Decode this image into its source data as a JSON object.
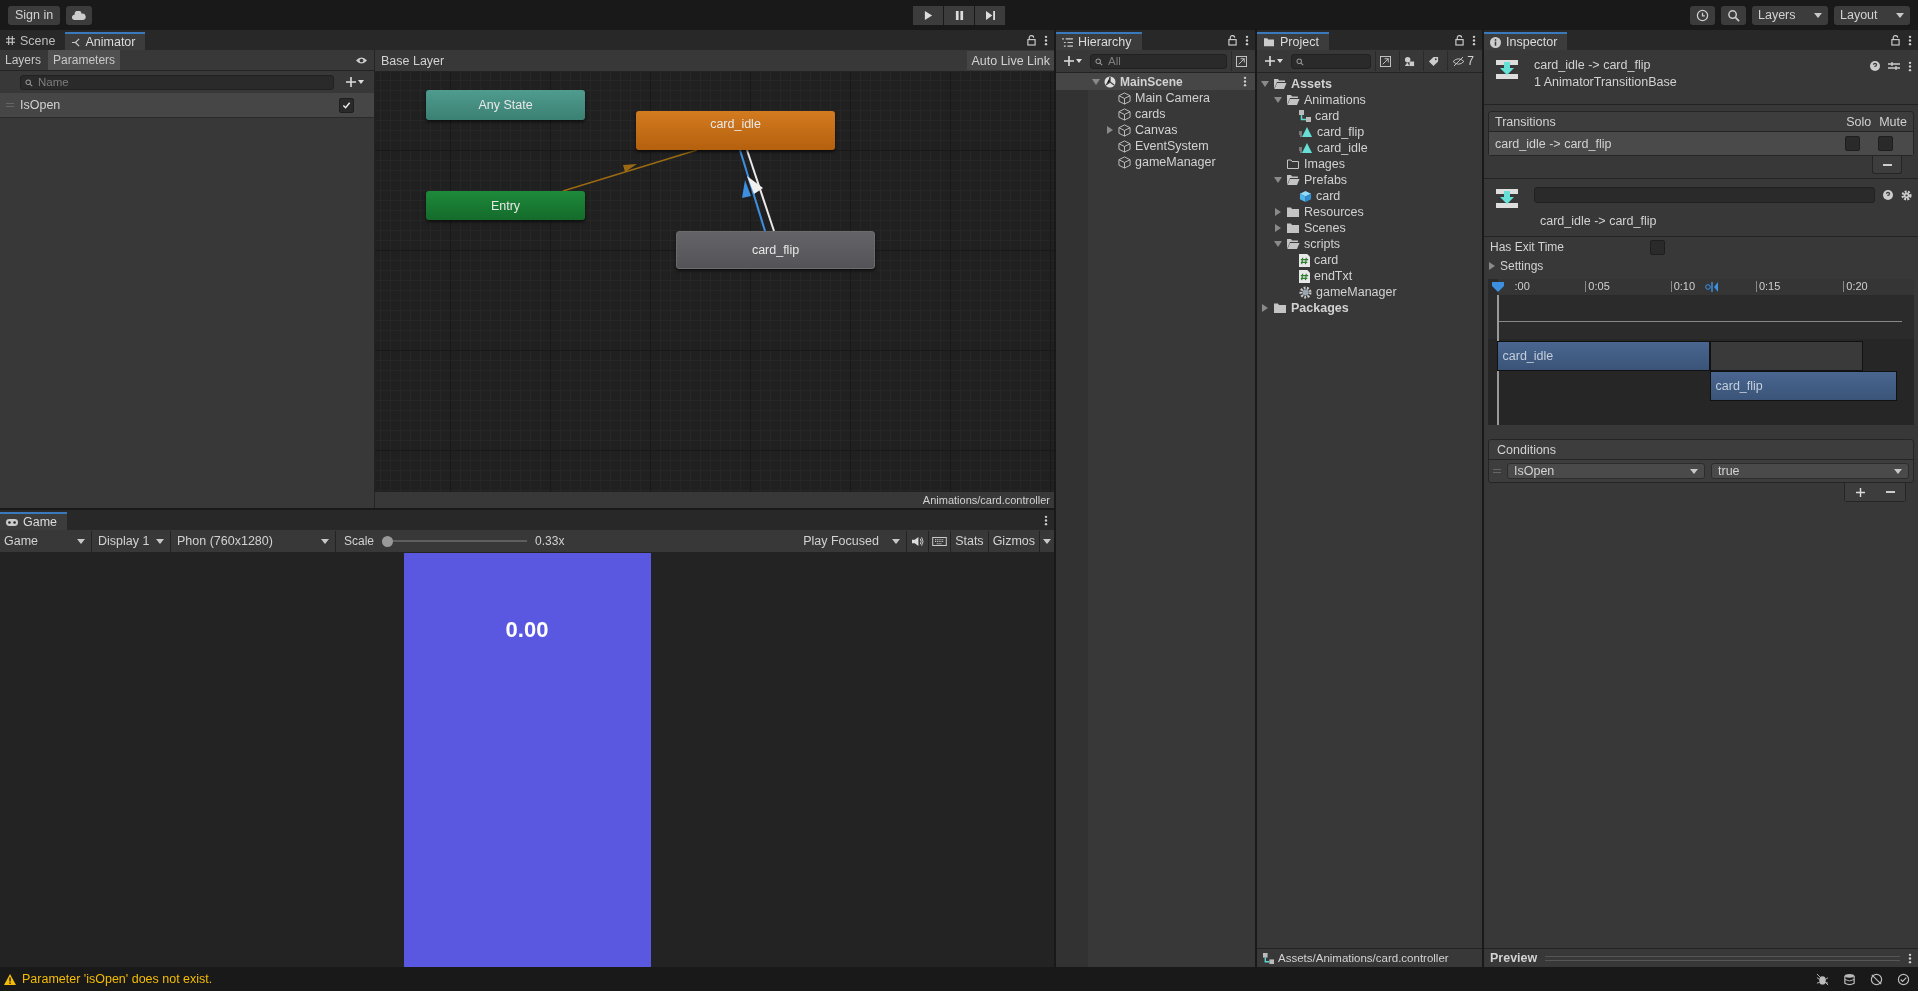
{
  "toolbar": {
    "sign_in": "Sign in",
    "layers": "Layers",
    "layout": "Layout"
  },
  "scene_tabs": [
    {
      "label": "Scene",
      "selected": false
    },
    {
      "label": "Animator",
      "selected": true
    }
  ],
  "animator": {
    "sidebar_tabs": [
      {
        "label": "Layers",
        "selected": false
      },
      {
        "label": "Parameters",
        "selected": true
      }
    ],
    "search_placeholder": "Name",
    "parameters": [
      {
        "name": "IsOpen",
        "checked": true
      }
    ],
    "breadcrumb": "Base Layer",
    "auto_live_link": "Auto Live Link",
    "states": [
      {
        "label": "Any State",
        "kind": "any"
      },
      {
        "label": "card_idle",
        "kind": "default"
      },
      {
        "label": "Entry",
        "kind": "entry"
      },
      {
        "label": "card_flip",
        "kind": "normal"
      }
    ],
    "footer": "Animations/card.controller"
  },
  "game": {
    "tab": "Game",
    "dropdowns": [
      "Game",
      "Display 1",
      "Phon (760x1280)"
    ],
    "scale_label": "Scale",
    "scale": {
      "level": 0.0,
      "reading": "0.33x"
    },
    "play_mode": "Play Focused",
    "stats": "Stats",
    "gizmos": "Gizmos",
    "score": "0.00"
  },
  "hierarchy": {
    "title": "Hierarchy",
    "search_placeholder": "All",
    "scene": "MainScene",
    "items": [
      {
        "label": "Main Camera",
        "collapsed": false
      },
      {
        "label": "cards",
        "collapsed": false
      },
      {
        "label": "Canvas",
        "collapsed": true
      },
      {
        "label": "EventSystem",
        "collapsed": false
      },
      {
        "label": "gameManager",
        "collapsed": false
      }
    ]
  },
  "project": {
    "title": "Project",
    "hidden_count": "7",
    "tree": [
      {
        "label": "Assets",
        "kind": "folder",
        "expanded": true,
        "children": [
          {
            "label": "Animations",
            "kind": "folder",
            "expanded": true,
            "children": [
              {
                "label": "card",
                "kind": "controller"
              },
              {
                "label": "card_flip",
                "kind": "clip"
              },
              {
                "label": "card_idle",
                "kind": "clip"
              }
            ]
          },
          {
            "label": "Images",
            "kind": "folder"
          },
          {
            "label": "Prefabs",
            "kind": "folder",
            "expanded": true,
            "children": [
              {
                "label": "card",
                "kind": "prefab"
              }
            ]
          },
          {
            "label": "Resources",
            "kind": "folder",
            "expanded": false
          },
          {
            "label": "Scenes",
            "kind": "folder",
            "expanded": false
          },
          {
            "label": "scripts",
            "kind": "folder",
            "expanded": true,
            "children": [
              {
                "label": "card",
                "kind": "script"
              },
              {
                "label": "endTxt",
                "kind": "script"
              },
              {
                "label": "gameManager",
                "kind": "settings"
              }
            ]
          }
        ]
      },
      {
        "label": "Packages",
        "kind": "folder",
        "expanded": false
      }
    ],
    "footer": "Assets/Animations/card.controller"
  },
  "inspector": {
    "title": "Inspector",
    "heading": "card_idle -> card_flip",
    "subheading": "1 AnimatorTransitionBase",
    "transitions": {
      "header": "Transitions",
      "solo": "Solo",
      "mute": "Mute",
      "rows": [
        {
          "label": "card_idle -> card_flip",
          "selected": true,
          "solo": false,
          "mute": false
        }
      ]
    },
    "transition_name": "card_idle -> card_flip",
    "has_exit_time": {
      "label": "Has Exit Time",
      "checked": false
    },
    "settings": {
      "label": "Settings",
      "expanded": false
    },
    "ticks": [
      ":00",
      "0:05",
      "0:10",
      "0:15",
      "0:20"
    ],
    "clips": [
      {
        "label": "card_idle"
      },
      {
        "label": "card_flip"
      }
    ],
    "conditions": {
      "header": "Conditions",
      "rows": [
        {
          "parameter": "IsOpen",
          "value": "true"
        }
      ]
    },
    "preview": "Preview"
  },
  "status": {
    "message": "Parameter 'isOpen' does not exist."
  }
}
